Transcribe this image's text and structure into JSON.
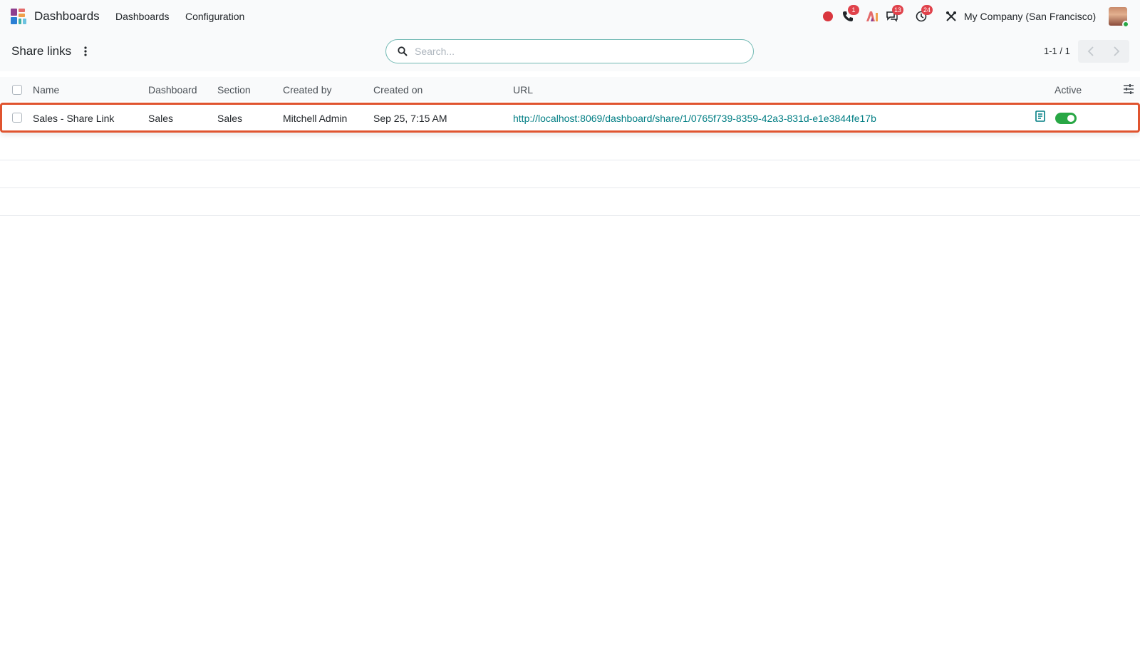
{
  "navbar": {
    "app_name": "Dashboards",
    "menus": [
      "Dashboards",
      "Configuration"
    ],
    "systray": {
      "phone_badge": "1",
      "messages_badge": "13",
      "activities_badge": "24",
      "company": "My Company (San Francisco)"
    }
  },
  "control_panel": {
    "title": "Share links",
    "search_placeholder": "Search...",
    "search_value": "",
    "pager_value": "1-1 / 1"
  },
  "list": {
    "columns": [
      "Name",
      "Dashboard",
      "Section",
      "Created by",
      "Created on",
      "URL",
      "Active"
    ],
    "rows": [
      {
        "name": "Sales - Share Link",
        "dashboard": "Sales",
        "section": "Sales",
        "created_by": "Mitchell Admin",
        "created_on": "Sep 25, 7:15 AM",
        "url": "http://localhost:8069/dashboard/share/1/0765f739-8359-42a3-831d-e1e3844fe17b",
        "active": true
      }
    ]
  },
  "colors": {
    "accent": "#017e84",
    "record_red": "#d9363e",
    "badge": "#e0424b",
    "toggle_on": "#28a745",
    "row_highlight": "#e0542f"
  }
}
